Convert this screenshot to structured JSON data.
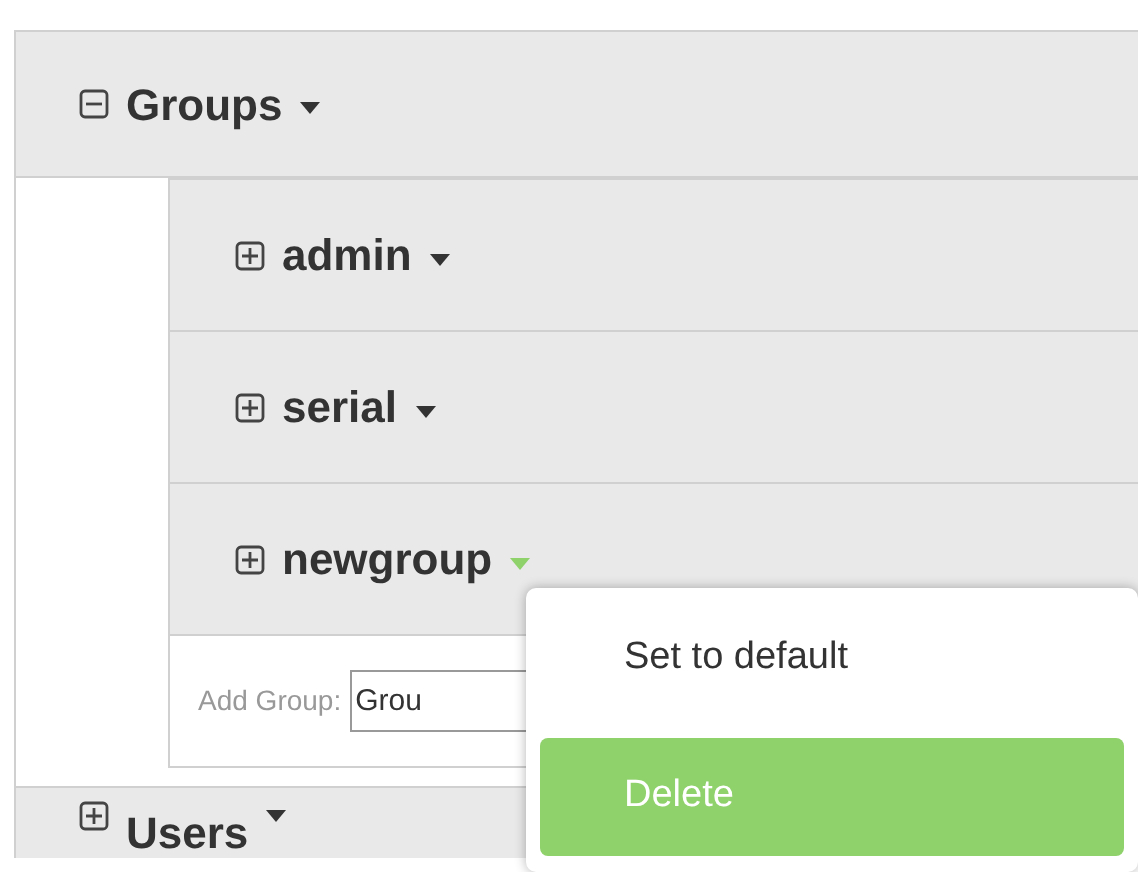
{
  "sections": [
    {
      "label": "Groups",
      "expanded": true,
      "menu_open": false,
      "children": [
        {
          "label": "admin",
          "expanded": false,
          "menu_open": false
        },
        {
          "label": "serial",
          "expanded": false,
          "menu_open": false
        },
        {
          "label": "newgroup",
          "expanded": false,
          "menu_open": true
        }
      ],
      "add_field": {
        "label": "Add Group:",
        "value": "Grou"
      }
    },
    {
      "label": "Users",
      "expanded": false,
      "menu_open": false
    }
  ],
  "context_menu": {
    "items": [
      {
        "label": "Set to default",
        "selected": false
      },
      {
        "label": "Delete",
        "selected": true
      }
    ]
  }
}
